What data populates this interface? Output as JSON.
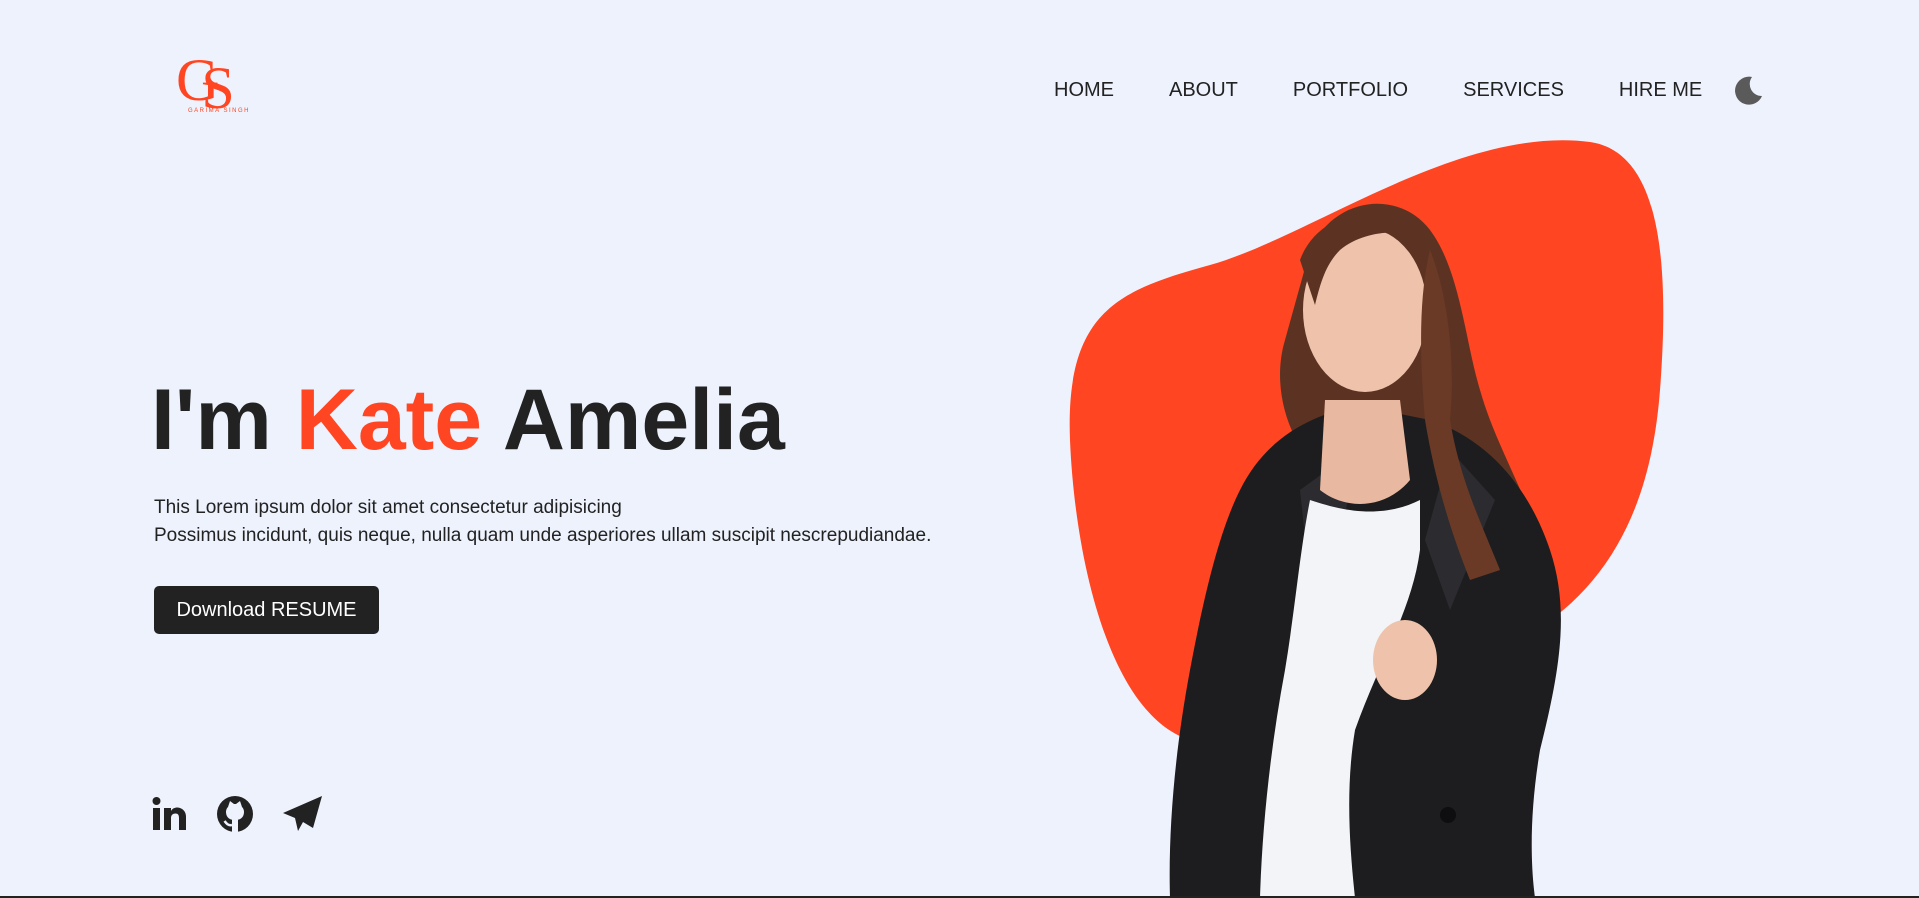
{
  "logo": {
    "mark": "GS",
    "subtitle": "GARIMA SINGH"
  },
  "nav": {
    "items": [
      "HOME",
      "ABOUT",
      "PORTFOLIO",
      "SERVICES",
      "HIRE ME"
    ],
    "theme_toggle_icon": "moon-icon"
  },
  "hero": {
    "title_prefix": "I'm ",
    "title_accent": "Kate",
    "title_suffix": " Amelia",
    "desc_line1": "This Lorem ipsum dolor sit amet consectetur adipisicing",
    "desc_line2": "Possimus incidunt, quis neque, nulla quam unde asperiores ullam suscipit nescrepudiandae.",
    "button_label": "Download RESUME"
  },
  "social": [
    "linkedin-icon",
    "github-icon",
    "telegram-icon"
  ],
  "colors": {
    "accent": "#ff4522",
    "dark": "#222222",
    "background": "#edf2fc"
  }
}
